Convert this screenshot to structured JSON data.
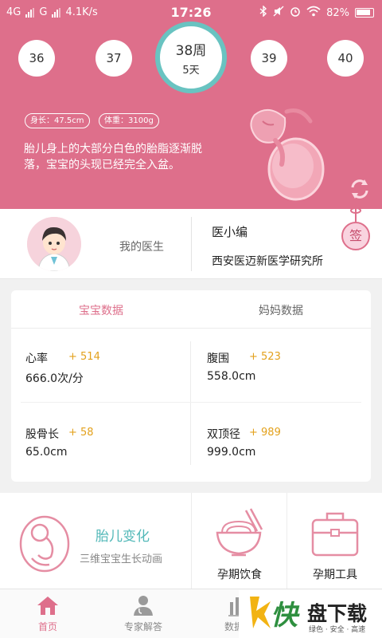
{
  "status_bar": {
    "network_1": "4G",
    "network_2": "G",
    "speed": "4.1K/s",
    "time": "17:26",
    "battery": "82%"
  },
  "week_selector": {
    "weeks": [
      "36",
      "37",
      "39",
      "40"
    ],
    "current_week": "38周",
    "current_day": "5天",
    "accent": "#69c3c1"
  },
  "baby": {
    "length": "身长：47.5cm",
    "weight": "体重：3100g",
    "description": "胎儿身上的大部分白色的胎脂逐渐脱落，宝宝的头现已经完全入盆。"
  },
  "doctor": {
    "label": "我的医生",
    "name": "医小编",
    "institution": "西安医迈新医学研究所",
    "sign_label": "签"
  },
  "data_card": {
    "tabs": [
      "宝宝数据",
      "妈妈数据"
    ],
    "metrics": [
      {
        "label": "心率",
        "delta": "+ 514",
        "value": "666.0次/分"
      },
      {
        "label": "腹围",
        "delta": "+ 523",
        "value": "558.0cm"
      },
      {
        "label": "股骨长",
        "delta": "+ 58",
        "value": "65.0cm"
      },
      {
        "label": "双顶径",
        "delta": "+ 989",
        "value": "999.0cm"
      }
    ]
  },
  "tiles": {
    "fetal_change": {
      "title": "胎儿变化",
      "subtitle": "三维宝宝生长动画"
    },
    "diet": "孕期饮食",
    "tools": "孕期工具"
  },
  "tab_bar": {
    "items": [
      "首页",
      "专家解答",
      "数据管"
    ]
  },
  "watermark": {
    "char1": "快",
    "brand": "盘下载",
    "slogan": "绿色 · 安全 · 高速"
  },
  "colors": {
    "brand_pink": "#de6f8b",
    "teal": "#52b8b8",
    "delta": "#e3a11c"
  }
}
